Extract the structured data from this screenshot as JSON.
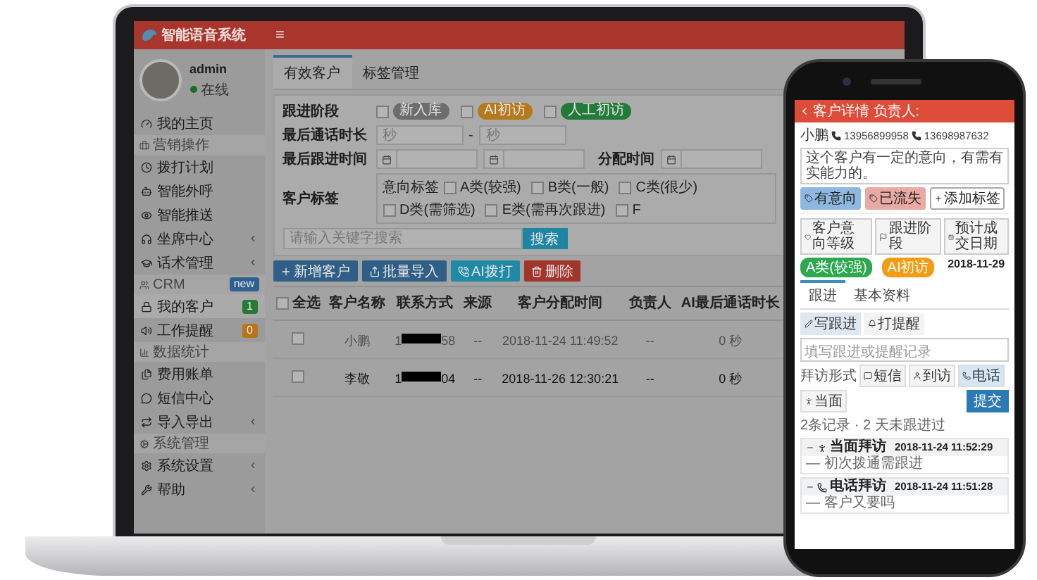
{
  "app": {
    "logo": "智能语音系统",
    "menu": "≡"
  },
  "user": {
    "name": "admin",
    "status": "在线",
    "online": true
  },
  "sidebar": {
    "items": [
      {
        "kind": "item",
        "label": "我的主页",
        "selected": false,
        "has_submenu": false
      },
      {
        "kind": "section",
        "label": "营销操作"
      },
      {
        "kind": "item",
        "label": "拨打计划",
        "selected": false,
        "has_submenu": false
      },
      {
        "kind": "item",
        "label": "智能外呼",
        "selected": false,
        "has_submenu": false
      },
      {
        "kind": "item",
        "label": "智能推送",
        "selected": false,
        "has_submenu": false
      },
      {
        "kind": "item",
        "label": "坐席中心",
        "selected": false,
        "has_submenu": true
      },
      {
        "kind": "item",
        "label": "话术管理",
        "selected": false,
        "has_submenu": true
      },
      {
        "kind": "section",
        "label": "CRM",
        "badge": {
          "text": "new",
          "color": "#2f5f8f"
        }
      },
      {
        "kind": "item",
        "label": "我的客户",
        "selected": true,
        "has_submenu": false,
        "badge": {
          "text": "1",
          "color": "#267a36"
        }
      },
      {
        "kind": "item",
        "label": "工作提醒",
        "selected": false,
        "has_submenu": false,
        "badge": {
          "text": "0",
          "color": "#b87418"
        }
      },
      {
        "kind": "section",
        "label": "数据统计"
      },
      {
        "kind": "item",
        "label": "费用账单",
        "selected": false,
        "has_submenu": false
      },
      {
        "kind": "item",
        "label": "短信中心",
        "selected": false,
        "has_submenu": false
      },
      {
        "kind": "item",
        "label": "导入导出",
        "selected": false,
        "has_submenu": true
      },
      {
        "kind": "section",
        "label": "系统管理"
      },
      {
        "kind": "item",
        "label": "系统设置",
        "selected": false,
        "has_submenu": true
      },
      {
        "kind": "item",
        "label": "帮助",
        "selected": false,
        "has_submenu": true
      }
    ]
  },
  "main": {
    "tabs": [
      {
        "label": "有效客户",
        "selected": true
      },
      {
        "label": "标签管理",
        "selected": false
      }
    ],
    "filters": [
      {
        "kind": "stages",
        "label": "跟进阶段",
        "options": [
          {
            "label": "新入库",
            "checked": false,
            "color": "#6d6d6d"
          },
          {
            "label": "AI初访",
            "checked": false,
            "color": "#b57a1e"
          },
          {
            "label": "人工初访",
            "checked": false,
            "color": "#237a3a"
          }
        ]
      },
      {
        "kind": "range",
        "label": "最后通话时长",
        "from_placeholder": "秒",
        "separator": "-",
        "to_placeholder": "秒"
      },
      {
        "kind": "dates",
        "label": "最后跟进时间",
        "extra_label": "分配时间"
      },
      {
        "kind": "tags",
        "label": "客户标签",
        "group": "意向标签",
        "options": [
          {
            "label": "A类(较强)",
            "checked": false
          },
          {
            "label": "B类(一般)",
            "checked": false
          },
          {
            "label": "C类(很少)",
            "checked": false
          },
          {
            "label": "D类(需筛选)",
            "checked": false
          },
          {
            "label": "E类(需再次跟进)",
            "checked": false
          },
          {
            "label": "F",
            "checked": false
          }
        ]
      }
    ],
    "search": {
      "placeholder": "请输入关键字搜索",
      "button": "搜索"
    },
    "actions": [
      {
        "kind": "add",
        "label": "新增客户"
      },
      {
        "kind": "import",
        "label": "批量导入"
      },
      {
        "kind": "call",
        "label": "AI拨打"
      },
      {
        "kind": "delete",
        "label": "删除"
      }
    ],
    "table": {
      "select_all": {
        "label": "全选",
        "checked": false
      },
      "columns": [
        "客户名称",
        "联系方式",
        "来源",
        "客户分配时间",
        "负责人",
        "AI最后通话时长"
      ],
      "rows": [
        {
          "checked": false,
          "muted": true,
          "name": "小鹏",
          "phone_start": "1",
          "phone_end": "58",
          "source": "--",
          "assigned": "2018-11-24 11:49:52",
          "owner": "--",
          "duration": "0 秒"
        },
        {
          "checked": false,
          "muted": false,
          "name": "李敬",
          "phone_start": "1",
          "phone_end": "04",
          "source": "--",
          "assigned": "2018-11-26 12:30:21",
          "owner": "--",
          "duration": "0 秒"
        }
      ]
    }
  },
  "phone": {
    "header": "客户详情 负责人:",
    "name": "小鹏",
    "numbers": [
      "13956899958",
      "13698987632"
    ],
    "note": "这个客户有一定的意向，有需有实能力的。",
    "tags": [
      {
        "kind": "tag",
        "label": "有意向",
        "color": "#8fb8e0"
      },
      {
        "kind": "tag",
        "label": "已流失",
        "color": "#e9a9a4"
      },
      {
        "kind": "add",
        "label": "添加标签"
      }
    ],
    "fields": [
      {
        "button": "客户意向等级",
        "kind": "badge",
        "value": "A类(较强)",
        "color": "#2ea84f"
      },
      {
        "button": "跟进阶段",
        "kind": "badge",
        "value": "AI初访",
        "color": "#f39c12"
      },
      {
        "button": "预计成交日期",
        "kind": "text",
        "value": "2018-11-29"
      }
    ],
    "tabs": [
      {
        "label": "跟进",
        "selected": true
      },
      {
        "label": "基本资料",
        "selected": false
      }
    ],
    "subtabs": [
      {
        "label": "写跟进",
        "selected": true
      },
      {
        "label": "打提醒",
        "selected": false
      }
    ],
    "note_placeholder": "填写跟进或提醒记录",
    "visit_label": "拜访形式",
    "visit_types": [
      {
        "kind": "sms",
        "label": "短信",
        "selected": false
      },
      {
        "kind": "visit",
        "label": "到访",
        "selected": false
      },
      {
        "kind": "call",
        "label": "电话",
        "selected": true
      },
      {
        "kind": "meet",
        "label": "当面",
        "selected": false
      }
    ],
    "submit": "提交",
    "summary": "2条记录 · 2 天未跟进过",
    "records": [
      {
        "kind": "meet",
        "type": "当面拜访",
        "time": "2018-11-24 11:52:29",
        "note": "— 初次拨通需跟进"
      },
      {
        "kind": "call",
        "type": "电话拜访",
        "time": "2018-11-24 11:51:28",
        "note": "— 客户又要吗"
      }
    ]
  }
}
